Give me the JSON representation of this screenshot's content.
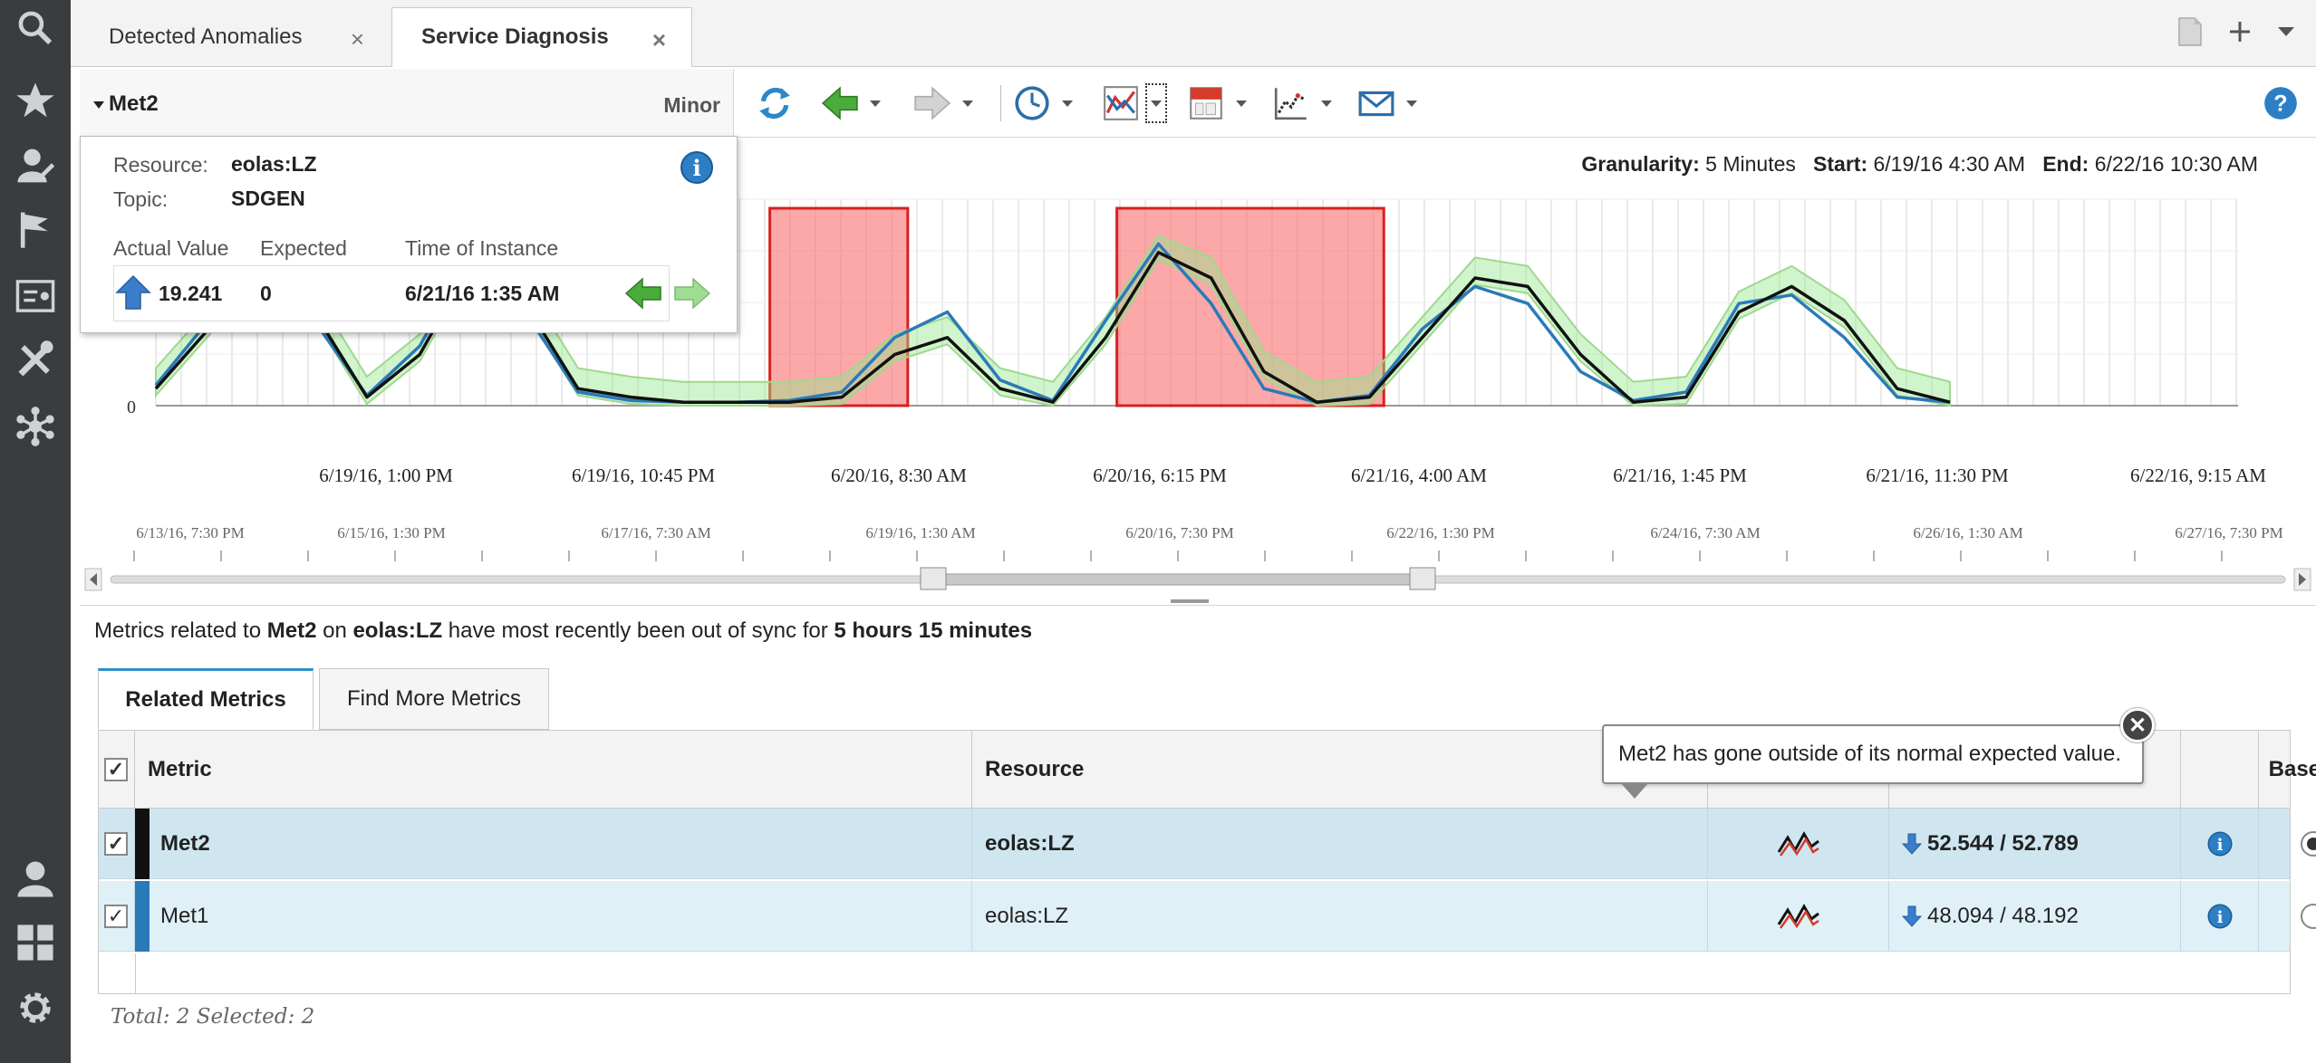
{
  "tabs": [
    {
      "label": "Detected Anomalies"
    },
    {
      "label": "Service Diagnosis"
    }
  ],
  "close_glyph": "×",
  "left_nav": [
    "search-icon",
    "star-icon",
    "user-edit-icon",
    "flag-icon",
    "dashboard-icon",
    "tools-icon",
    "network-icon",
    "user-icon",
    "grid-icon",
    "gear-icon"
  ],
  "toolbar": {
    "metric": "Met2",
    "severity": "Minor"
  },
  "granularity": {
    "gran_label": "Granularity:",
    "gran_value": "5 Minutes",
    "start_label": "Start:",
    "start_value": "6/19/16 4:30 AM",
    "end_label": "End:",
    "end_value": "6/22/16 10:30 AM"
  },
  "popup": {
    "resource_label": "Resource:",
    "resource_value": "eolas:LZ",
    "topic_label": "Topic:",
    "topic_value": "SDGEN",
    "actual_label": "Actual Value",
    "expected_label": "Expected",
    "time_label": "Time of Instance",
    "actual_value": "19.241",
    "expected_value": "0",
    "time_value": "6/21/16 1:35 AM"
  },
  "chart_data": [
    {
      "type": "line",
      "y_tick": "0",
      "x_tick_labels": [
        "6/19/16, 1:00 PM",
        "6/19/16, 10:45 PM",
        "6/20/16, 8:30 AM",
        "6/20/16, 6:15 PM",
        "6/21/16, 4:00 AM",
        "6/21/16, 1:45 PM",
        "6/21/16, 11:30 PM",
        "6/22/16, 9:15 AM"
      ],
      "anomaly_windows": [
        [
          "6/20/16 3:30 AM",
          "6/20/16 8:40 AM"
        ],
        [
          "6/20/16 4:30 PM",
          "6/21/16 2:30 AM"
        ]
      ],
      "series": [
        {
          "name": "Met2",
          "color": "#111111",
          "values": [
            0.1,
            0.45,
            0.8,
            0.55,
            0.05,
            0.3,
            0.85,
            0.6,
            0.1,
            0.05,
            0.02,
            0.02,
            0.02,
            0.05,
            0.3,
            0.4,
            0.1,
            0.02,
            0.4,
            0.9,
            0.75,
            0.2,
            0.02,
            0.05,
            0.4,
            0.75,
            0.7,
            0.3,
            0.02,
            0.05,
            0.55,
            0.7,
            0.5,
            0.1,
            0.02
          ]
        },
        {
          "name": "Met1",
          "color": "#2a7ab8",
          "values": [
            0.12,
            0.5,
            0.82,
            0.5,
            0.06,
            0.35,
            0.9,
            0.55,
            0.08,
            0.03,
            0.02,
            0.02,
            0.03,
            0.08,
            0.4,
            0.55,
            0.15,
            0.03,
            0.5,
            0.95,
            0.6,
            0.1,
            0.02,
            0.06,
            0.45,
            0.7,
            0.6,
            0.2,
            0.03,
            0.08,
            0.6,
            0.65,
            0.4,
            0.05,
            0.02
          ]
        }
      ]
    },
    {
      "type": "line",
      "x_tick_labels": [
        "6/13/16, 7:30 PM",
        "6/15/16, 1:30 PM",
        "6/17/16, 7:30 AM",
        "6/19/16, 1:30 AM",
        "6/20/16, 7:30 PM",
        "6/22/16, 1:30 PM",
        "6/24/16, 7:30 AM",
        "6/26/16, 1:30 AM",
        "6/27/16, 7:30 PM"
      ]
    }
  ],
  "sync": {
    "p1": "Metrics related to ",
    "metric": "Met2",
    "p2": " on ",
    "resource": "eolas:LZ",
    "p3": " have most recently been out of sync for ",
    "duration": "5 hours 15 minutes"
  },
  "bottom_tabs": [
    "Related Metrics",
    "Find More Metrics"
  ],
  "grid": {
    "headers": {
      "metric": "Metric",
      "resource": "Resource",
      "baseline": "Baseline"
    },
    "rows": [
      {
        "metric": "Met2",
        "resource": "eolas:LZ",
        "values": "52.544 / 52.789",
        "color": "#111111",
        "baseline": true
      },
      {
        "metric": "Met1",
        "resource": "eolas:LZ",
        "values": "48.094 / 48.192",
        "color": "#2a7ab8",
        "baseline": false
      }
    ],
    "footer": "Total: 2 Selected: 2"
  },
  "tooltip": "Met2 has gone outside of its normal expected value."
}
